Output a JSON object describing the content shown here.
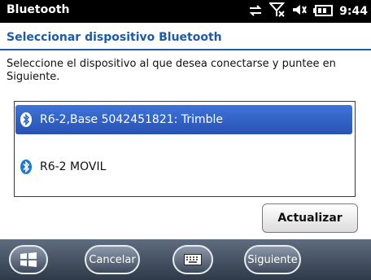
{
  "statusbar": {
    "title": "Bluetooth",
    "time": "9:44",
    "icons": [
      "sync-arrows-icon",
      "no-signal-icon",
      "speaker-icon",
      "battery-icon"
    ]
  },
  "header": {
    "title": "Seleccionar dispositivo Bluetooth"
  },
  "instruction": "Seleccione el dispositivo al que desea conectarse y puntee en Siguiente.",
  "devices": [
    {
      "label": "R6-2,Base 5042451821: Trimble",
      "selected": true
    },
    {
      "label": "R6-2 MOVIL",
      "selected": false
    }
  ],
  "buttons": {
    "refresh": "Actualizar",
    "cancel": "Cancelar",
    "next": "Siguiente"
  },
  "colors": {
    "accent": "#1d5ba8",
    "selection": "#3463c7",
    "bluetooth": "#1f78d1"
  }
}
